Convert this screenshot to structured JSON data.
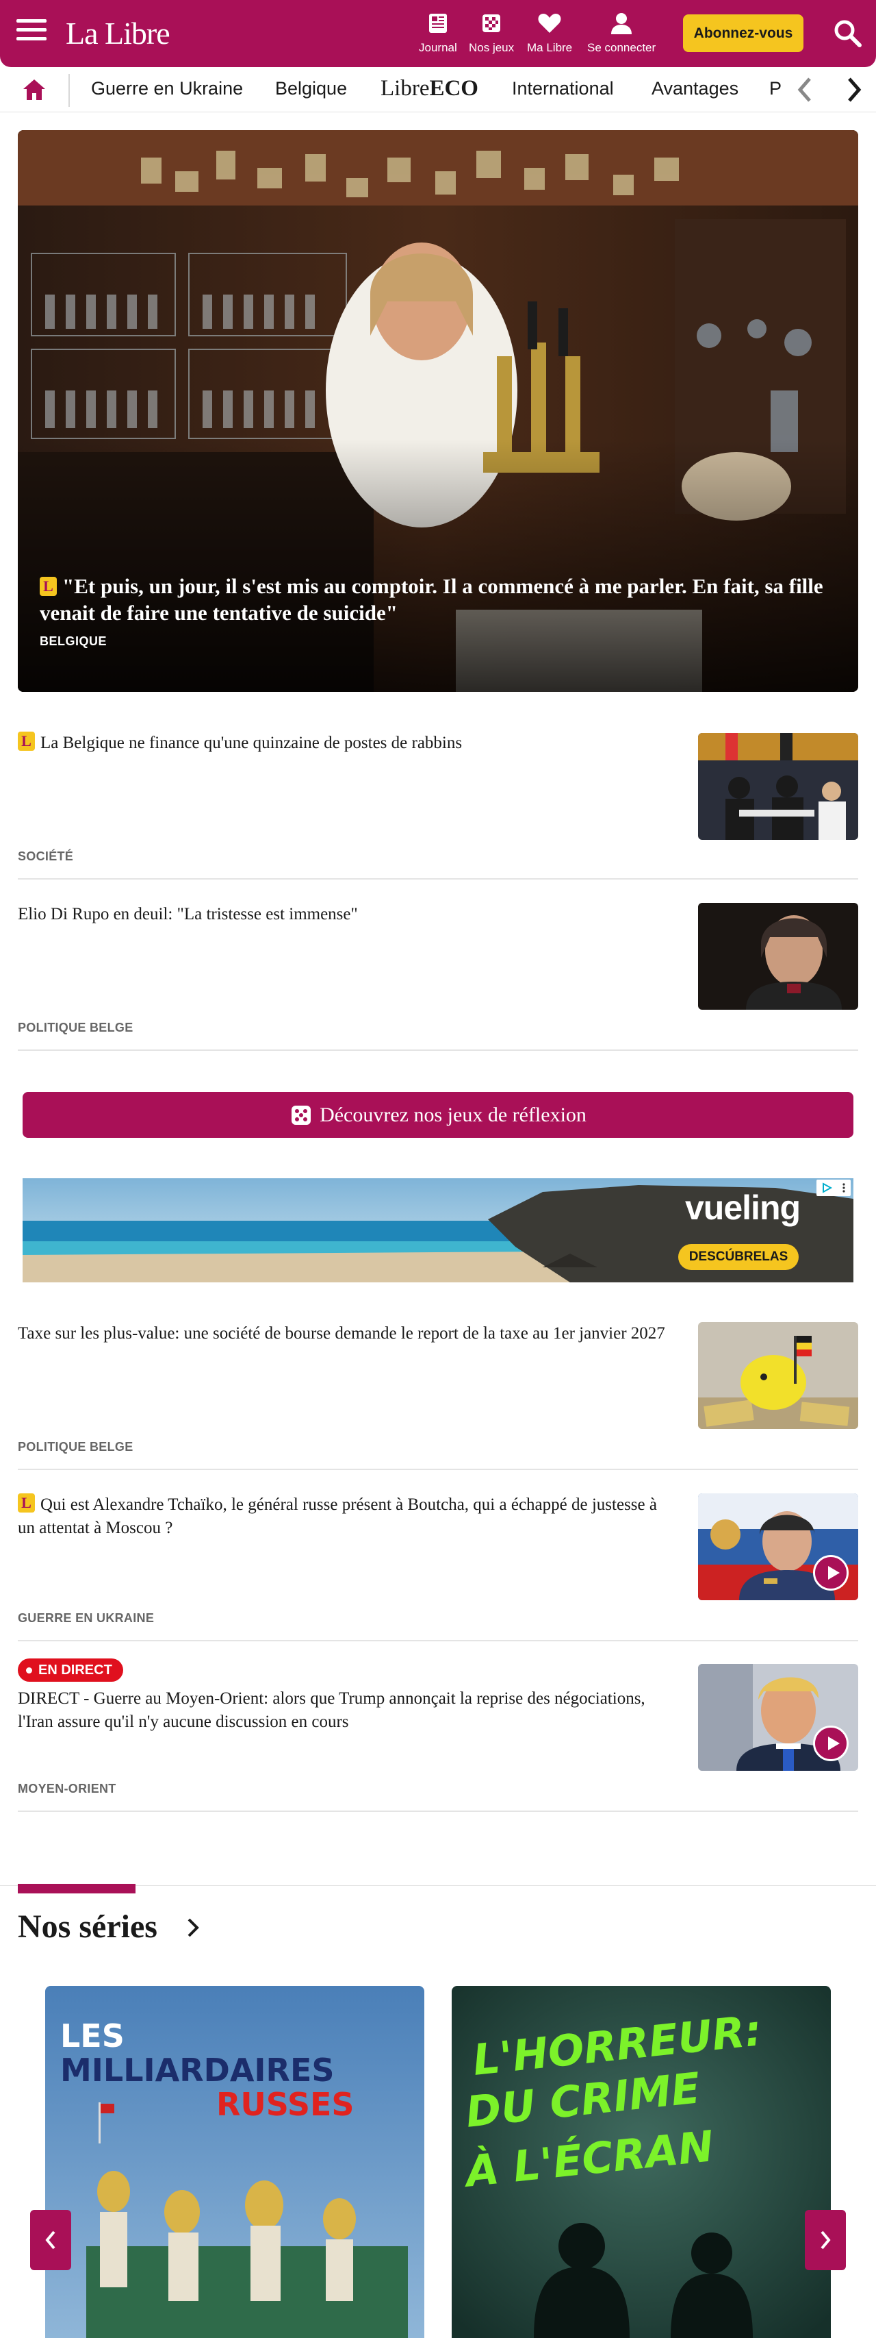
{
  "brand": {
    "logo_text": "La Libre",
    "accent": "#a91057",
    "gold": "#f5c51f"
  },
  "header": {
    "nav": [
      {
        "label": "Journal",
        "icon": "newspaper-icon"
      },
      {
        "label": "Nos jeux",
        "icon": "games-grid-icon"
      },
      {
        "label": "Ma Libre",
        "icon": "heart-icon"
      },
      {
        "label": "Se connecter",
        "icon": "user-icon"
      }
    ],
    "subscribe_label": "Abonnez-vous"
  },
  "sections": {
    "items": [
      "Guerre en Ukraine",
      "Belgique",
      "International",
      "Avantages",
      "P"
    ],
    "eco_logo": {
      "part1": "Libre",
      "part2": "ECO"
    }
  },
  "hero": {
    "badge": "L",
    "title": "\"Et puis, un jour, il s'est mis au comptoir. Il a commencé à me parler. En fait, sa fille venait de faire une tentative de suicide\"",
    "category": "BELGIQUE"
  },
  "articles": [
    {
      "premium": true,
      "title": "La Belgique ne finance qu'une quinzaine de postes de rabbins",
      "category": "SOCIÉTÉ",
      "video": false
    },
    {
      "premium": false,
      "title": "Elio Di Rupo en deuil: \"La tristesse est immense\"",
      "category": "POLITIQUE BELGE",
      "video": false
    },
    {
      "premium": false,
      "title": "Taxe sur les plus-value: une société de bourse demande le report de la taxe au 1er janvier 2027",
      "category": "POLITIQUE BELGE",
      "video": false
    },
    {
      "premium": true,
      "title": "Qui est Alexandre Tchaïko, le général russe présent à Boutcha, qui a échappé de justesse à un attentat à Moscou ?",
      "category": "GUERRE EN UKRAINE",
      "video": true
    },
    {
      "premium": false,
      "live": "EN DIRECT",
      "title": "DIRECT - Guerre au Moyen-Orient: alors que Trump annonçait la reprise des négociations, l'Iran assure qu'il n'y aucune discussion en cours",
      "category": "MOYEN-ORIENT",
      "video": true
    }
  ],
  "games_banner": {
    "label": "Découvrez nos jeux de réflexion",
    "icon": "dice-icon"
  },
  "ad": {
    "brand": "vueling",
    "cta": "DESCÚBRELAS"
  },
  "series": {
    "title": "Nos séries",
    "cards": [
      {
        "line1": "LES",
        "line2": "MILLIARDAIRES",
        "line3": "RUSSES"
      },
      {
        "line1": "L'HORREUR:",
        "line2": "DU CRIME",
        "line3": "À L'ÉCRAN"
      }
    ]
  }
}
